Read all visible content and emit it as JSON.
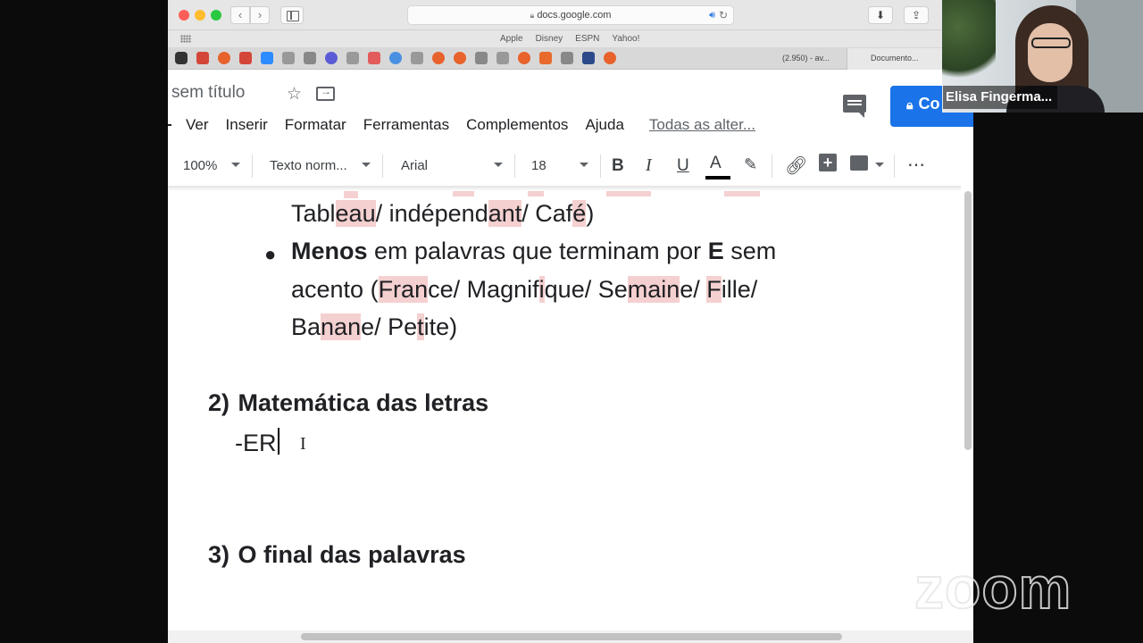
{
  "browser": {
    "url": "docs.google.com",
    "favorites": [
      "Apple",
      "Disney",
      "ESPN",
      "Yahoo!"
    ],
    "tabs": [
      "(2.950) - av...",
      "Documento..."
    ]
  },
  "docs": {
    "title": "sem título",
    "share_label": "Co",
    "menu": [
      "Ver",
      "Inserir",
      "Formatar",
      "Ferramentas",
      "Complementos",
      "Ajuda"
    ],
    "changes_link": "Todas as alter...",
    "toolbar": {
      "zoom": "100%",
      "style": "Texto norm...",
      "font": "Arial",
      "size": "18"
    }
  },
  "document": {
    "line1": [
      "Tabl",
      "eau",
      "/ indépend",
      "ant",
      "/ Caf",
      "é",
      ")"
    ],
    "bullet_bold": "Menos",
    "bullet_text": " em palavras que terminam por ",
    "bullet_E": "E",
    "bullet_text2": " sem",
    "line3": [
      "acento (",
      "Fran",
      "ce/ Magnif",
      "i",
      "que/ Se",
      "main",
      "e/ ",
      "F",
      "ille/"
    ],
    "line4": [
      "Ba",
      "nan",
      "e/ Pe",
      "t",
      "ite)"
    ],
    "heading2_num": "2)",
    "heading2": "Matemática das letras",
    "typed": "-ER",
    "heading3_num": "3)",
    "heading3": "O final das palavras"
  },
  "participant": {
    "name": "Elisa Fingerma..."
  },
  "watermark": "zoom"
}
